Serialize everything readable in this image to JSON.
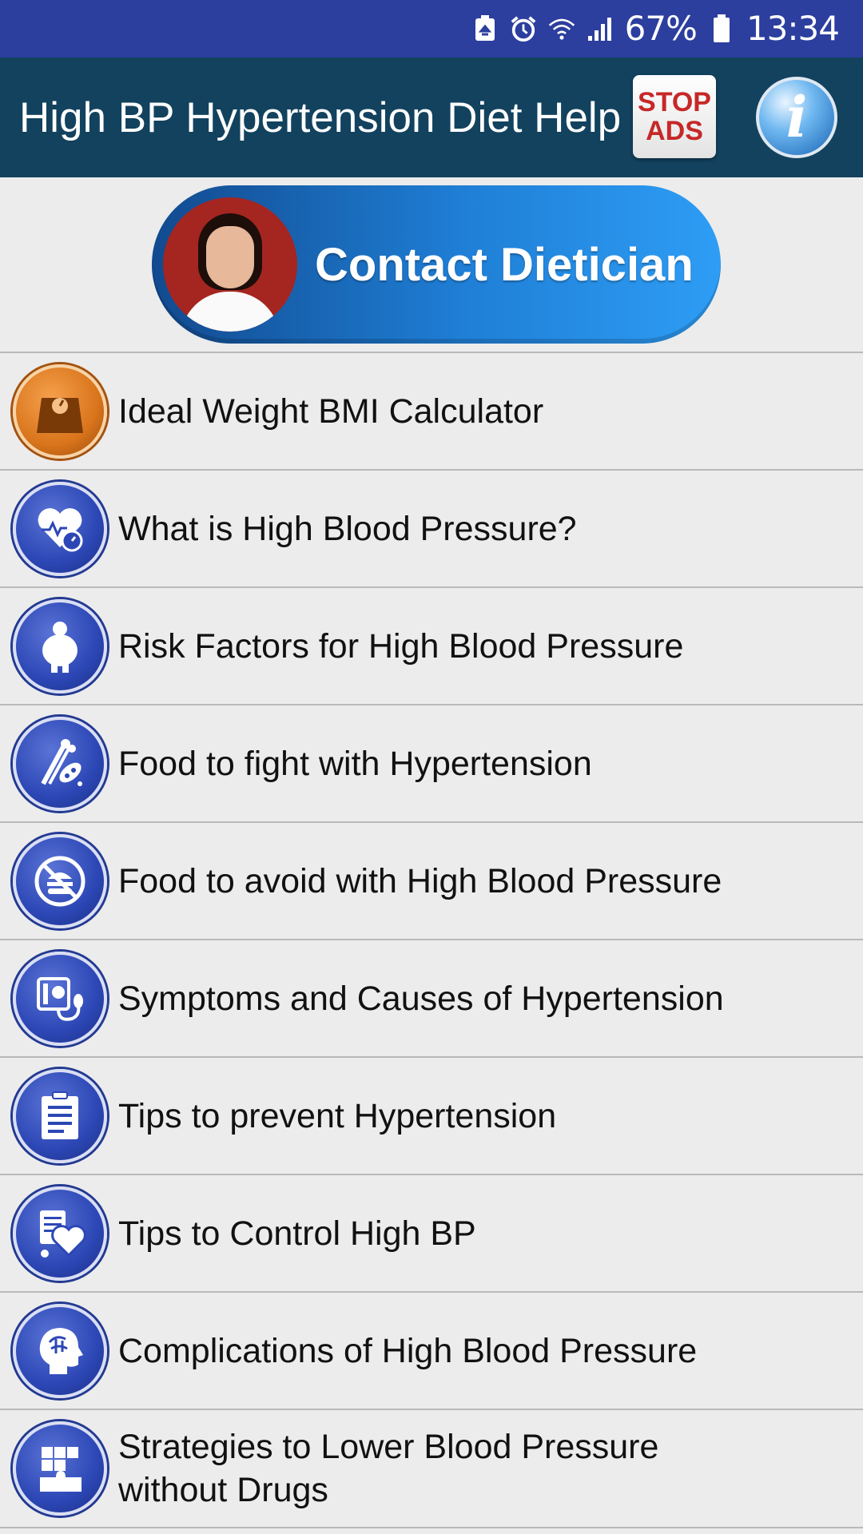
{
  "status_bar": {
    "icons": [
      "storage-saver-icon",
      "alarm-icon",
      "wifi-icon",
      "signal-icon",
      "battery-icon"
    ],
    "battery_percent": "67%",
    "time": "13:34",
    "color": "#2c3e9e"
  },
  "app_bar": {
    "title": "High BP Hypertension Diet Help",
    "stop_ads_line1": "STOP",
    "stop_ads_line2": "ADS",
    "info_glyph": "i",
    "color": "#12425e"
  },
  "banner": {
    "label": "Contact Dietician"
  },
  "menu": {
    "items": [
      {
        "label": "Ideal Weight BMI Calculator",
        "icon": "weighing-scale-icon"
      },
      {
        "label": "What is High Blood Pressure?",
        "icon": "heart-gauge-icon"
      },
      {
        "label": "Risk Factors for High Blood Pressure",
        "icon": "obese-person-icon"
      },
      {
        "label": "Food to fight with Hypertension",
        "icon": "vegetables-icon"
      },
      {
        "label": "Food to avoid with High Blood Pressure",
        "icon": "no-burger-icon"
      },
      {
        "label": "Symptoms and Causes of Hypertension",
        "icon": "bp-monitor-icon"
      },
      {
        "label": "Tips to prevent Hypertension",
        "icon": "clipboard-icon"
      },
      {
        "label": "Tips to Control High BP",
        "icon": "heart-document-icon"
      },
      {
        "label": "Complications of High Blood Pressure",
        "icon": "brain-head-icon"
      },
      {
        "label_line1": "Strategies to Lower Blood Pressure",
        "label_line2": "without Drugs",
        "icon": "strategy-puzzle-icon"
      }
    ]
  }
}
